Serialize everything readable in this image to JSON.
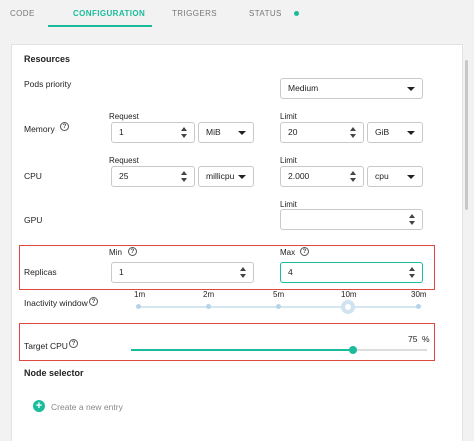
{
  "tabs": [
    {
      "label": "CODE"
    },
    {
      "label": "CONFIGURATION"
    },
    {
      "label": "TRIGGERS"
    },
    {
      "label": "STATUS"
    }
  ],
  "colors": {
    "accent": "#1abc9c",
    "highlight_box": "#e0483f"
  },
  "resources": {
    "title": "Resources",
    "pods_priority": {
      "label": "Pods priority",
      "value": "Medium"
    },
    "memory": {
      "label": "Memory",
      "request_label": "Request",
      "request_value": "1",
      "request_unit": "MiB",
      "limit_label": "Limit",
      "limit_value": "20",
      "limit_unit": "GiB"
    },
    "cpu": {
      "label": "CPU",
      "request_label": "Request",
      "request_value": "25",
      "request_unit": "millicpu",
      "limit_label": "Limit",
      "limit_value": "2.000",
      "limit_unit": "cpu"
    },
    "gpu": {
      "label": "GPU",
      "limit_label": "Limit",
      "limit_value": ""
    },
    "replicas": {
      "label": "Replicas",
      "min_label": "Min",
      "min_value": "1",
      "max_label": "Max",
      "max_value": "4"
    },
    "inactivity_window": {
      "label": "Inactivity window",
      "options": [
        "1m",
        "2m",
        "5m",
        "10m",
        "30m"
      ],
      "selected": "10m"
    },
    "target_cpu": {
      "label": "Target CPU",
      "value": "75",
      "unit": "%",
      "fraction": 0.75
    }
  },
  "node_selector": {
    "title": "Node selector",
    "add_label": "Create a new entry"
  }
}
